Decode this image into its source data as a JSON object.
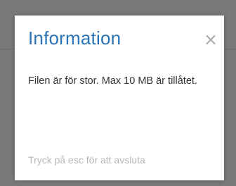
{
  "dialog": {
    "title": "Information",
    "close_glyph": "×",
    "close_icon": "close-icon",
    "message": "Filen är för stor. Max 10 MB är tillåtet.",
    "hint": "Tryck på esc för att avsluta"
  },
  "colors": {
    "title": "#2b73b5",
    "backdrop": "#797979",
    "hint": "#b8b8b8"
  }
}
